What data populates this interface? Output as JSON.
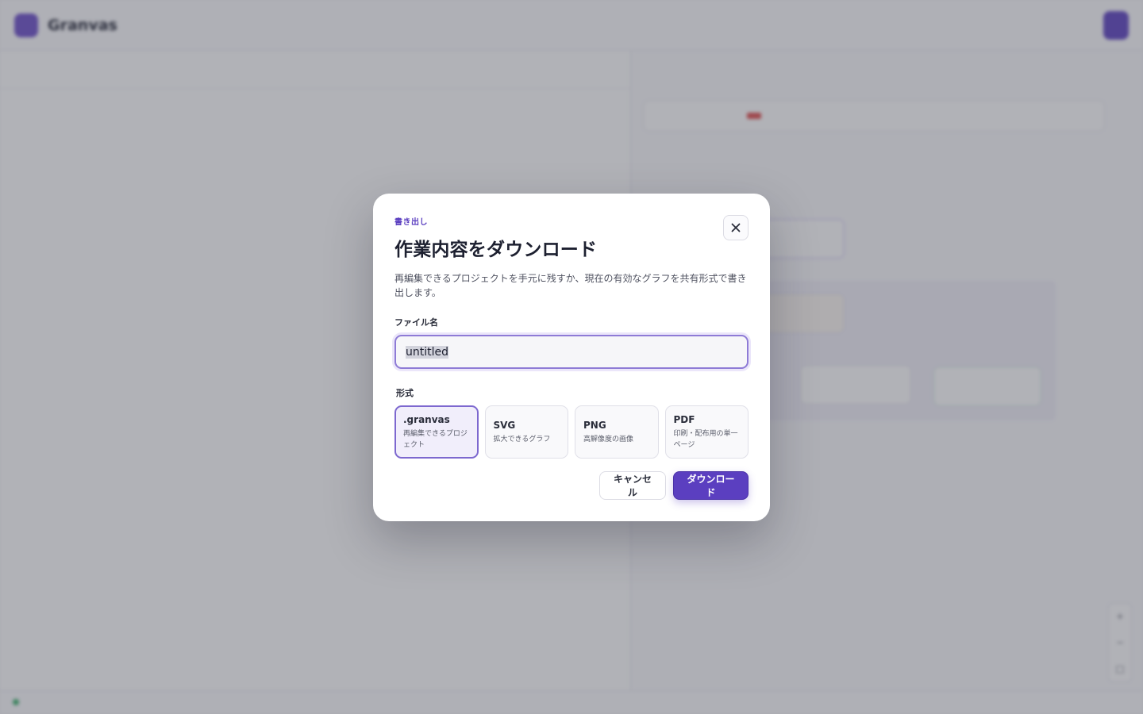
{
  "app": {
    "name": "Granvas",
    "crumb": "",
    "top_link": "",
    "top_button": ""
  },
  "modal": {
    "eyebrow": "書き出し",
    "title": "作業内容をダウンロード",
    "description": "再編集できるプロジェクトを手元に残すか、現在の有効なグラフを共有形式で書き出します。",
    "filename_label": "ファイル名",
    "filename_value": "untitled",
    "format_label": "形式",
    "formats": [
      {
        "name": ".granvas",
        "desc": "再編集できるプロジェクト",
        "selected": true
      },
      {
        "name": "SVG",
        "desc": "拡大できるグラフ",
        "selected": false
      },
      {
        "name": "PNG",
        "desc": "高解像度の画像",
        "selected": false
      },
      {
        "name": "PDF",
        "desc": "印刷・配布用の単一ページ",
        "selected": false
      }
    ],
    "cancel_label": "キャンセル",
    "download_label": "ダウンロード"
  },
  "colors": {
    "accent": "#5b3fc0",
    "accent_light": "#f1eefb",
    "overlay": "#464854"
  },
  "icons": {
    "close": "close-icon",
    "logo": "logo-icon"
  }
}
